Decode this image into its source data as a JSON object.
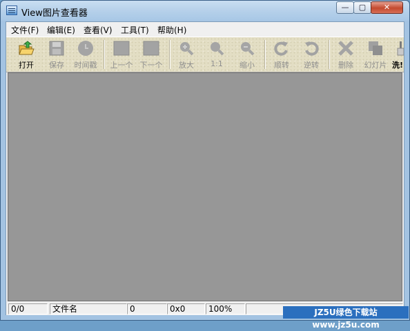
{
  "window": {
    "title": "View图片查看器"
  },
  "controls": {
    "minimize": "—",
    "maximize": "▢",
    "close": "✕"
  },
  "menu": {
    "items": [
      {
        "label": "文件(F)"
      },
      {
        "label": "编辑(E)"
      },
      {
        "label": "查看(V)"
      },
      {
        "label": "工具(T)"
      },
      {
        "label": "帮助(H)"
      }
    ]
  },
  "toolbar": {
    "buttons": [
      {
        "label": "打开",
        "icon": "open-folder-icon",
        "enabled": true
      },
      {
        "label": "保存",
        "icon": "save-icon",
        "enabled": false
      },
      {
        "label": "时间戳",
        "icon": "timestamp-icon",
        "enabled": false
      },
      {
        "label": "上一个",
        "icon": "previous-icon",
        "enabled": false
      },
      {
        "label": "下一个",
        "icon": "next-icon",
        "enabled": false
      },
      {
        "label": "放大",
        "icon": "zoom-in-icon",
        "enabled": false
      },
      {
        "label": "1:1",
        "icon": "actual-size-icon",
        "enabled": false
      },
      {
        "label": "缩小",
        "icon": "zoom-out-icon",
        "enabled": false
      },
      {
        "label": "顺转",
        "icon": "rotate-clockwise-icon",
        "enabled": false
      },
      {
        "label": "逆转",
        "icon": "rotate-counterclockwise-icon",
        "enabled": false
      },
      {
        "label": "删除",
        "icon": "delete-icon",
        "enabled": false
      },
      {
        "label": "幻灯片",
        "icon": "slideshow-icon",
        "enabled": false
      },
      {
        "label": "洗!",
        "icon": "wash-icon",
        "enabled": true
      }
    ]
  },
  "status": {
    "index": "0/0",
    "filename": "文件名",
    "filesize": "0",
    "dimensions": "0x0",
    "zoom": "100%"
  },
  "watermark": {
    "text": "JZ5U绿色下载站www.jz5u.com"
  },
  "colors": {
    "viewer_bg": "#979797",
    "toolbar_bg": "#e3dec4",
    "watermark_bg": "#2b6fbe"
  }
}
